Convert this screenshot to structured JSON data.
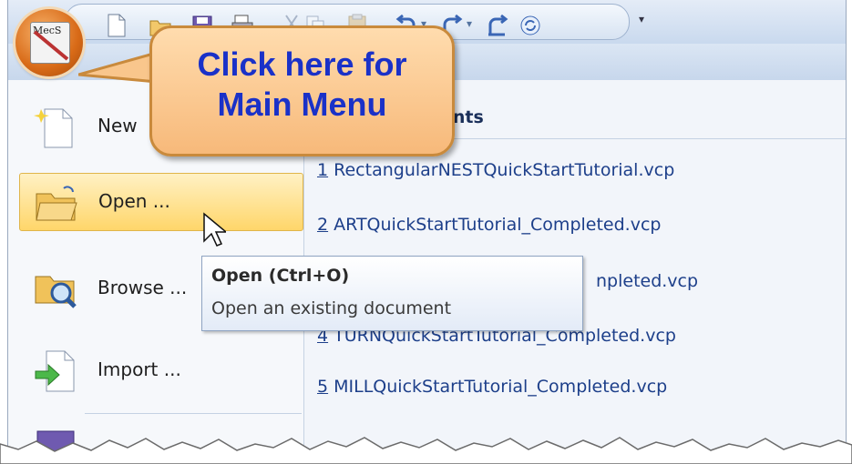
{
  "app_button": {
    "logo_text": "MecS"
  },
  "callout": {
    "line1": "Click here for",
    "line2": "Main Menu"
  },
  "menu": {
    "items": [
      {
        "label": "New",
        "icon": "new-document-icon"
      },
      {
        "label": "Open ...",
        "icon": "open-folder-icon"
      },
      {
        "label": "Browse ...",
        "icon": "browse-folder-icon"
      },
      {
        "label": "Import ...",
        "icon": "import-icon"
      }
    ]
  },
  "recent": {
    "header_visible": "ents",
    "items": [
      {
        "num": "1",
        "name": " RectangularNESTQuickStartTutorial.vcp"
      },
      {
        "num": "2",
        "name": " ARTQuickStartTutorial_Completed.vcp"
      },
      {
        "num": "",
        "name": "npleted.vcp"
      },
      {
        "num": "4",
        "name": " TURNQuickStartTutorial_Completed.vcp"
      },
      {
        "num": "5",
        "name": " MILLQuickStartTutorial_Completed.vcp"
      }
    ]
  },
  "tooltip": {
    "title": "Open (Ctrl+O)",
    "description": "Open an existing document"
  },
  "colors": {
    "accent": "#d86a17",
    "link": "#1d3f8a",
    "callout_text": "#1a31c8",
    "hover": "#ffd66a"
  }
}
